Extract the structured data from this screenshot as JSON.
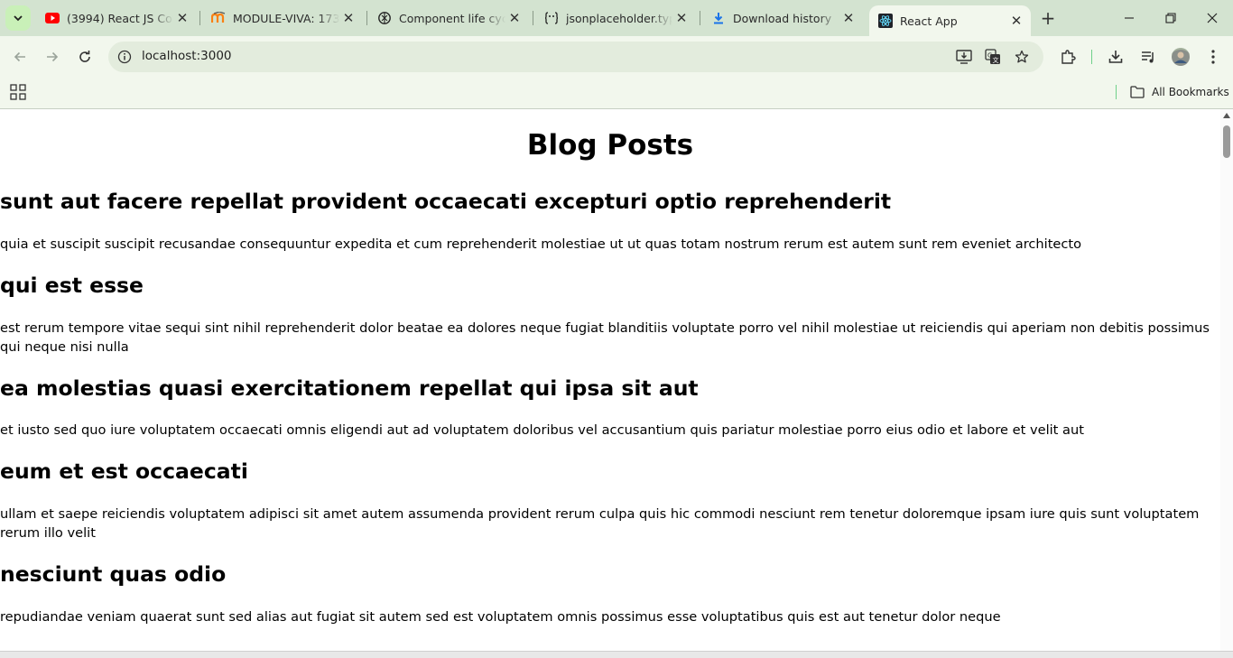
{
  "tabs": [
    {
      "title": "(3994) React JS Cours",
      "favicon": "youtube-icon"
    },
    {
      "title": "MODULE-VIVA: 1731-",
      "favicon": "moodle-icon"
    },
    {
      "title": "Component life cycle",
      "favicon": "chatgpt-icon"
    },
    {
      "title": "jsonplaceholder.typic",
      "favicon": "jsonplaceholder-icon"
    },
    {
      "title": "Download history",
      "favicon": "download-icon"
    },
    {
      "title": "React App",
      "favicon": "react-icon",
      "active": true
    }
  ],
  "address_bar": {
    "url": "localhost:3000"
  },
  "bookmarks": {
    "all_label": "All Bookmarks"
  },
  "page": {
    "heading": "Blog Posts",
    "posts": [
      {
        "title": "sunt aut facere repellat provident occaecati excepturi optio reprehenderit",
        "body": "quia et suscipit suscipit recusandae consequuntur expedita et cum reprehenderit molestiae ut ut quas totam nostrum rerum est autem sunt rem eveniet architecto"
      },
      {
        "title": "qui est esse",
        "body": "est rerum tempore vitae sequi sint nihil reprehenderit dolor beatae ea dolores neque fugiat blanditiis voluptate porro vel nihil molestiae ut reiciendis qui aperiam non debitis possimus qui neque nisi nulla"
      },
      {
        "title": "ea molestias quasi exercitationem repellat qui ipsa sit aut",
        "body": "et iusto sed quo iure voluptatem occaecati omnis eligendi aut ad voluptatem doloribus vel accusantium quis pariatur molestiae porro eius odio et labore et velit aut"
      },
      {
        "title": "eum et est occaecati",
        "body": "ullam et saepe reiciendis voluptatem adipisci sit amet autem assumenda provident rerum culpa quis hic commodi nesciunt rem tenetur doloremque ipsam iure quis sunt voluptatem rerum illo velit"
      },
      {
        "title": "nesciunt quas odio",
        "body": "repudiandae veniam quaerat sunt sed alias aut fugiat sit autem sed est voluptatem omnis possimus esse voluptatibus quis est aut tenetur dolor neque"
      }
    ]
  },
  "colors": {
    "tabstrip": "#d3e3d0",
    "toolbar": "#f2f7ed",
    "omnibox": "#e3ecdd",
    "youtube_red": "#ff0000",
    "download_blue": "#1a73e8",
    "moodle_orange": "#f98012"
  }
}
